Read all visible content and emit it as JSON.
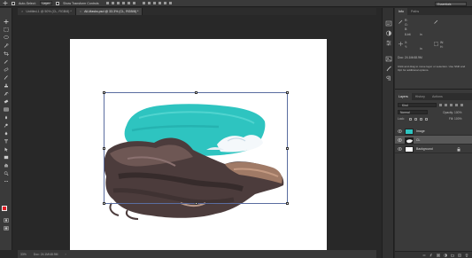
{
  "options_bar": {
    "auto_select_label": "Auto-Select:",
    "auto_select_target": "Layer",
    "transform_label": "Show Transform Controls",
    "workspace": "Essentials"
  },
  "tabs": [
    {
      "label": "Untitled-1 @ 50% (CL, RGB/8) *"
    },
    {
      "label": "All-Masks.psd @ 33.3% (CL, RGB/8) *"
    }
  ],
  "status_bar": {
    "zoom": "33%",
    "doc_size": "Doc: 24.1M/48.9M"
  },
  "panels": {
    "info": {
      "tabs": [
        "Info",
        "Paths"
      ],
      "r_label": "R:",
      "g_label": "G:",
      "b_label": "B:",
      "x_label": "X:",
      "y_label": "Y:",
      "w_label": "W:",
      "h_label": "H:",
      "bit_depth": "8-bit",
      "unit": "in",
      "doc_size": "Doc: 24.1M/48.9M",
      "description": "Click and drag to move layer or selection. Use Shift and Opt for additional options."
    },
    "layers": {
      "tabs": [
        "Layers",
        "History",
        "Actions"
      ],
      "filter": "Kind",
      "blend_mode": "Normal",
      "opacity": "Opacity: 100%",
      "lock": "Lock:",
      "fill": "Fill: 100%",
      "items": [
        {
          "name": "Image"
        },
        {
          "name": "CL"
        },
        {
          "name": "Background"
        }
      ]
    }
  },
  "colors": {
    "foreground": "#e21b23",
    "background": "#ffffff",
    "sky": "#2ec4c0"
  }
}
